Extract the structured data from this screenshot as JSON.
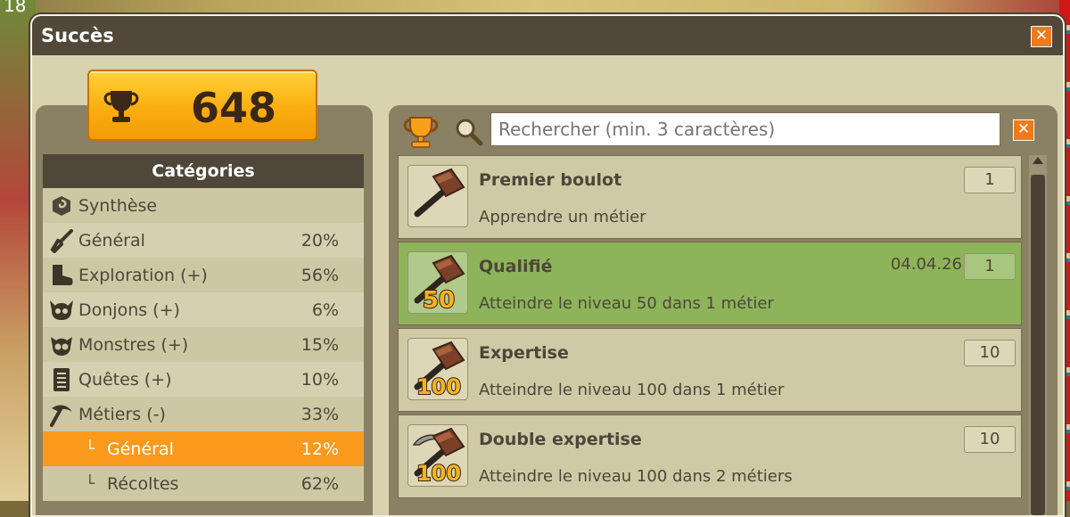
{
  "background": {
    "corner_number": "18"
  },
  "window": {
    "title": "Succès",
    "close": "✕"
  },
  "score": {
    "value": "648"
  },
  "categories": {
    "header": "Catégories",
    "items": [
      {
        "icon": "spiral-icon",
        "label": "Synthèse",
        "pct": ""
      },
      {
        "icon": "sword-icon",
        "label": "Général",
        "pct": "20%"
      },
      {
        "icon": "boot-icon",
        "label": "Exploration (+)",
        "pct": "56%"
      },
      {
        "icon": "skull-icon",
        "label": "Donjons (+)",
        "pct": "6%"
      },
      {
        "icon": "monster-icon",
        "label": "Monstres (+)",
        "pct": "15%"
      },
      {
        "icon": "scroll-icon",
        "label": "Quêtes (+)",
        "pct": "10%"
      },
      {
        "icon": "pickaxe-icon",
        "label": "Métiers (-)",
        "pct": "33%"
      }
    ],
    "subitems": [
      {
        "mark": "└",
        "label": "Général",
        "pct": "12%",
        "active": true
      },
      {
        "mark": "└",
        "label": "Récoltes",
        "pct": "62%",
        "active": false
      }
    ]
  },
  "search": {
    "placeholder": "Rechercher (min. 3 caractères)",
    "clear": "✕"
  },
  "achievements": [
    {
      "name": "Premier boulot",
      "desc": "Apprendre un métier",
      "date": "",
      "points": "1",
      "badge": "",
      "done": false,
      "icon": "hammer-icon"
    },
    {
      "name": "Qualifié",
      "desc": "Atteindre le niveau 50 dans 1 métier",
      "date": "04.04.26",
      "points": "1",
      "badge": "50",
      "done": true,
      "icon": "hammer-50-icon"
    },
    {
      "name": "Expertise",
      "desc": "Atteindre le niveau 100 dans 1 métier",
      "date": "",
      "points": "10",
      "badge": "100",
      "done": false,
      "icon": "hammer-100-icon"
    },
    {
      "name": "Double expertise",
      "desc": "Atteindre le niveau 100 dans 2 métiers",
      "date": "",
      "points": "10",
      "badge": "100",
      "done": false,
      "icon": "hammer-pickaxe-100-icon"
    }
  ]
}
